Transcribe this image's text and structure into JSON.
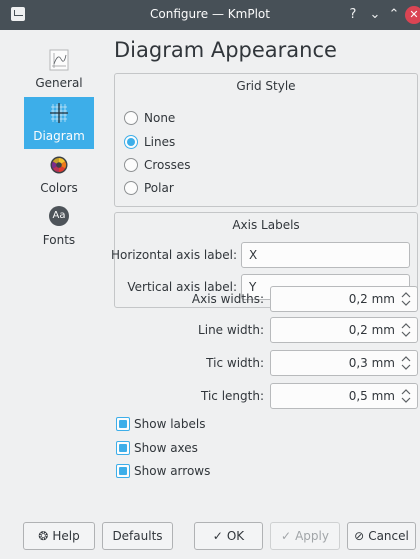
{
  "window": {
    "title": "Configure — KmPlot",
    "help_glyph": "?",
    "minimize_glyph": "⌄",
    "maximize_glyph": "⌃",
    "close_glyph": "✕"
  },
  "nav": {
    "items": [
      {
        "label": "General",
        "icon": "general-icon",
        "selected": false
      },
      {
        "label": "Diagram",
        "icon": "diagram-grid-icon",
        "selected": true
      },
      {
        "label": "Colors",
        "icon": "color-wheel-icon",
        "selected": false
      },
      {
        "label": "Fonts",
        "icon": "fonts-icon",
        "selected": false
      }
    ],
    "fonts_icon_text": "Aa"
  },
  "page": {
    "title": "Diagram Appearance"
  },
  "grid_style": {
    "title": "Grid Style",
    "options": [
      {
        "label": "None",
        "checked": false
      },
      {
        "label": "Lines",
        "checked": true
      },
      {
        "label": "Crosses",
        "checked": false
      },
      {
        "label": "Polar",
        "checked": false
      }
    ]
  },
  "axis_labels": {
    "title": "Axis Labels",
    "horizontal_label": "Horizontal axis label:",
    "horizontal_value": "X",
    "vertical_label": "Vertical axis label:",
    "vertical_value": "Y"
  },
  "sizes": [
    {
      "label": "Axis widths:",
      "value": "0,2 mm"
    },
    {
      "label": "Line width:",
      "value": "0,2 mm"
    },
    {
      "label": "Tic width:",
      "value": "0,3 mm"
    },
    {
      "label": "Tic length:",
      "value": "0,5 mm"
    }
  ],
  "options": [
    {
      "label": "Show labels",
      "checked": true
    },
    {
      "label": "Show axes",
      "checked": true
    },
    {
      "label": "Show arrows",
      "checked": true
    }
  ],
  "buttons": {
    "help": {
      "glyph": "❂",
      "label": "Help"
    },
    "defaults": {
      "label": "Defaults"
    },
    "ok": {
      "glyph": "✓",
      "label": "OK"
    },
    "apply": {
      "glyph": "✓",
      "label": "Apply",
      "enabled": false
    },
    "cancel": {
      "glyph": "⊘",
      "label": "Cancel"
    }
  },
  "colors": {
    "accent": "#3daee9",
    "titlebar": "#475057",
    "close": "#da4453",
    "background": "#eff0f1"
  }
}
